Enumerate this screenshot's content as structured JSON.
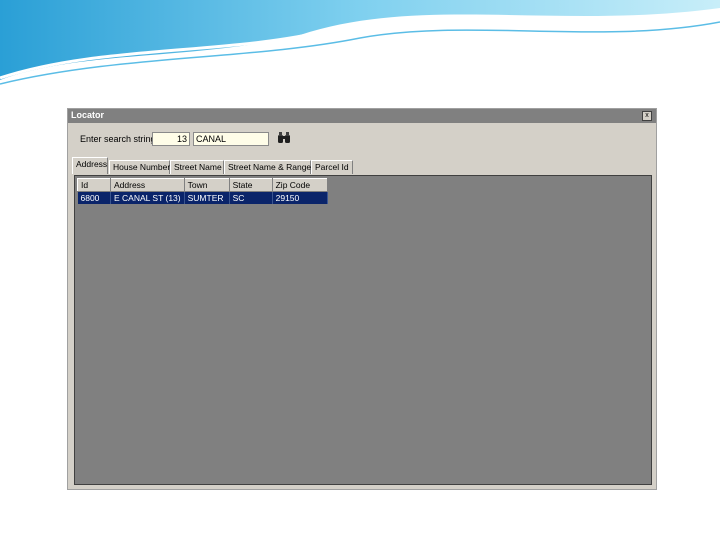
{
  "window": {
    "title": "Locator",
    "close_label": "x"
  },
  "search": {
    "label": "Enter search string",
    "number_value": "13",
    "text_value": "CANAL",
    "search_icon": "binoculars-icon"
  },
  "tabs": [
    "Address",
    "House Number",
    "Street Name",
    "Street Name & Range",
    "Parcel Id"
  ],
  "active_tab": "Address",
  "grid": {
    "columns": [
      "Id",
      "Address",
      "Town",
      "State",
      "Zip Code"
    ],
    "rows": [
      [
        "6800",
        "E CANAL ST (13)",
        "SUMTER",
        "SC",
        "29150"
      ]
    ],
    "selected_row": 0
  },
  "colors": {
    "grid_background": "#808080",
    "selection": "#0a246a",
    "window": "#d4d0c8"
  }
}
